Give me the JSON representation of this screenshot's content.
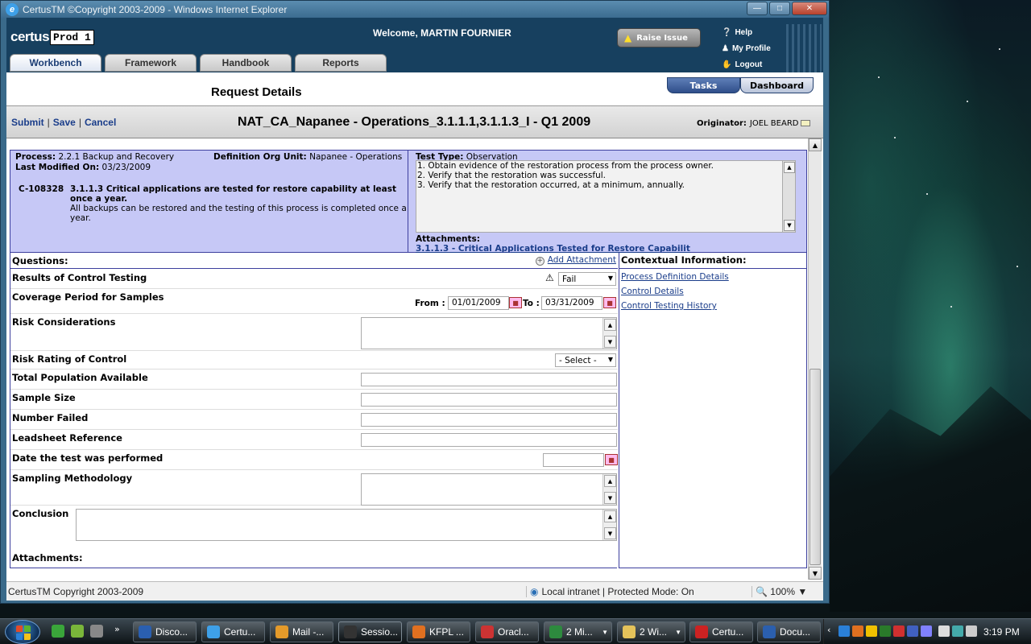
{
  "window": {
    "title": "CertusTM ©Copyright 2003-2009 - Windows Internet Explorer"
  },
  "header": {
    "logo_brand": "certus",
    "logo_env": "Prod 1",
    "welcome": "Welcome, MARTIN FOURNIER",
    "raise_issue": "Raise Issue",
    "links": {
      "help": "Help",
      "profile": "My Profile",
      "logout": "Logout"
    },
    "tabs": [
      {
        "label": "Workbench",
        "active": true
      },
      {
        "label": "Framework",
        "active": false
      },
      {
        "label": "Handbook",
        "active": false
      },
      {
        "label": "Reports",
        "active": false
      }
    ]
  },
  "subheader": {
    "title": "Request Details",
    "tasks": "Tasks",
    "dashboard": "Dashboard"
  },
  "actionbar": {
    "submit": "Submit",
    "save": "Save",
    "cancel": "Cancel",
    "sep": "|",
    "request_name": "NAT_CA_Napanee - Operations_3.1.1.1,3.1.1.3_I  - Q1 2009",
    "originator_label": "Originator:",
    "originator": "JOEL BEARD"
  },
  "info": {
    "process_label": "Process:",
    "process": "2.2.1 Backup and Recovery",
    "def_org_label": "Definition Org Unit:",
    "def_org": "Napanee - Operations",
    "modified_label": "Last Modified On:",
    "modified": "03/23/2009",
    "control_id": "C-108328",
    "control_title": "3.1.1.3 Critical applications are tested for restore capability at least once a year.",
    "control_desc": "All backups can be restored and the testing of this process is completed once a year.",
    "test_type_label": "Test Type:",
    "test_type": "Observation",
    "steps": [
      "1. Obtain evidence of the restoration process from the process owner.",
      "2. Verify that the restoration was successful.",
      "3. Verify that the restoration occurred, at a minimum, annually."
    ],
    "attachments_label": "Attachments:",
    "attachment_link": "3.1.1.3 - Critical Applications Tested for Restore Capabilit"
  },
  "questions": {
    "heading": "Questions:",
    "add_attachment": "Add Attachment",
    "results_label": "Results of Control Testing",
    "results_value": "Fail",
    "coverage_label": "Coverage Period for Samples",
    "from_label": "From :",
    "from_value": "01/01/2009",
    "to_label": "To :",
    "to_value": "03/31/2009",
    "risk_considerations_label": "Risk Considerations",
    "risk_rating_label": "Risk Rating of Control",
    "risk_rating_value": "- Select -",
    "population_label": "Total Population Available",
    "sample_size_label": "Sample Size",
    "failed_label": "Number Failed",
    "leadsheet_label": "Leadsheet Reference",
    "date_label": "Date the test was performed",
    "methodology_label": "Sampling Methodology",
    "conclusion_label": "Conclusion",
    "attachments_label": "Attachments:"
  },
  "contextual": {
    "heading": "Contextual Information:",
    "links": [
      "Process Definition Details",
      "Control Details",
      "Control Testing History"
    ]
  },
  "statusbar": {
    "left": "CertusTM Copyright 2003-2009",
    "zone": "Local intranet | Protected Mode: On",
    "zoom": "100%"
  },
  "taskbar": {
    "buttons": [
      "Disco...",
      "Certu...",
      "Mail -...",
      "Sessio...",
      "KFPL ...",
      "Oracl...",
      "2 Mi...",
      "2 Wi...",
      "Certu...",
      "Docu..."
    ],
    "clock": "3:19 PM"
  },
  "colors": {
    "header": "#17405f",
    "info_panel": "#c6c8f6",
    "link": "#1a3d8a"
  }
}
